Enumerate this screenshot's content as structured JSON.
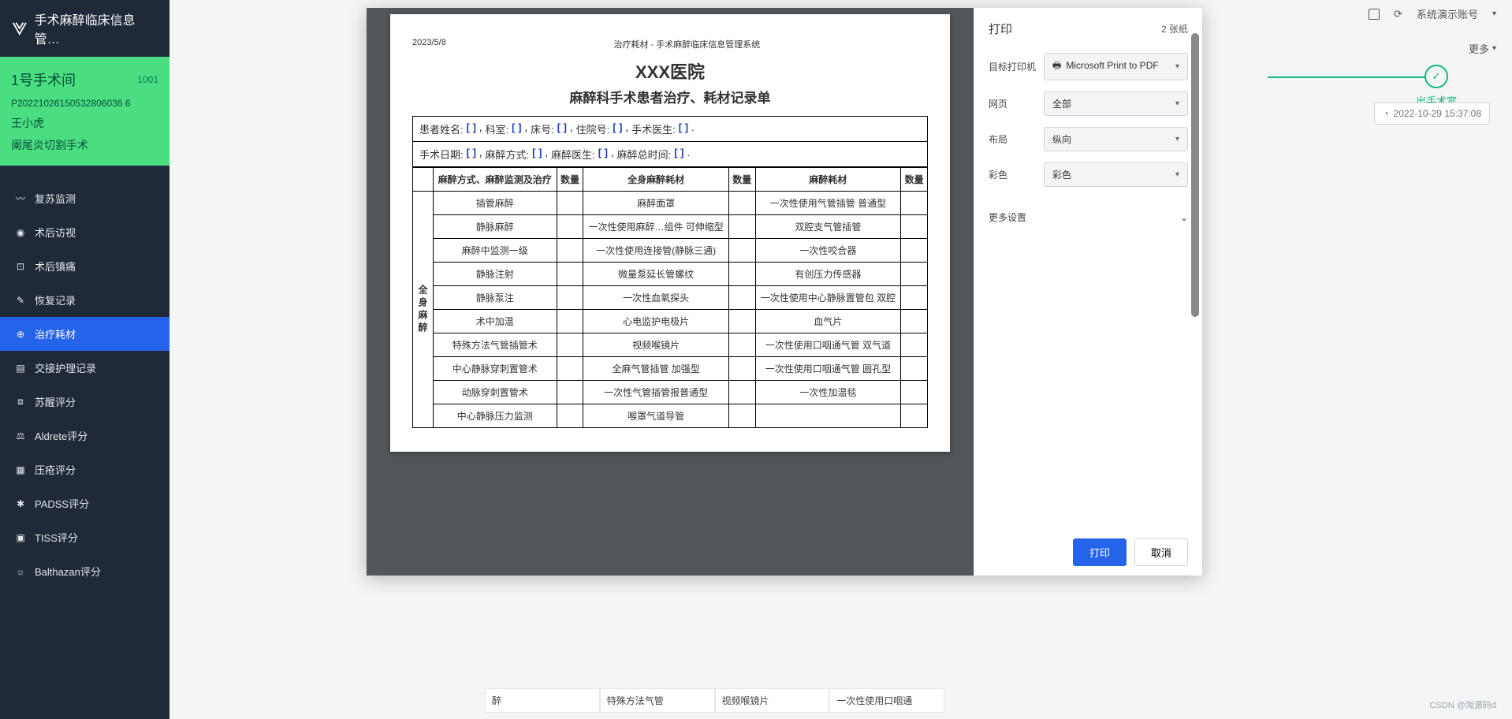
{
  "app_title": "手术麻醉临床信息管…",
  "room": {
    "name": "1号手术间",
    "number": "1001"
  },
  "patient": {
    "id": "P20221026150532806036 6",
    "name": "王小虎",
    "surgery": "阑尾炎切割手术"
  },
  "nav": [
    {
      "icon": "〰",
      "label": "复苏监测"
    },
    {
      "icon": "◉",
      "label": "术后访视"
    },
    {
      "icon": "⊡",
      "label": "术后镇痛"
    },
    {
      "icon": "✎",
      "label": "恢复记录"
    },
    {
      "icon": "⊕",
      "label": "治疗耗材"
    },
    {
      "icon": "▤",
      "label": "交接护理记录"
    },
    {
      "icon": "⧈",
      "label": "苏醒评分"
    },
    {
      "icon": "⚖",
      "label": "Aldrete评分"
    },
    {
      "icon": "▦",
      "label": "压疮评分"
    },
    {
      "icon": "✱",
      "label": "PADSS评分"
    },
    {
      "icon": "▣",
      "label": "TISS评分"
    },
    {
      "icon": "☼",
      "label": "Balthazan评分"
    }
  ],
  "topbar": {
    "account": "系统演示账号",
    "more": "更多"
  },
  "step": {
    "label": "出手术室",
    "timestamp": "2022-10-29 15:37:08"
  },
  "print": {
    "title": "打印",
    "sheets": "2 张纸",
    "settings": [
      {
        "label": "目标打印机",
        "value": "Microsoft Print to PDF",
        "icon": true
      },
      {
        "label": "网页",
        "value": "全部"
      },
      {
        "label": "布局",
        "value": "纵向"
      },
      {
        "label": "彩色",
        "value": "彩色"
      }
    ],
    "more_settings": "更多设置",
    "print_btn": "打印",
    "cancel_btn": "取消"
  },
  "doc": {
    "date": "2023/5/8",
    "header": "治疗耗材 - 手术麻醉临床信息管理系统",
    "hospital": "XXX医院",
    "title": "麻醉科手术患者治疗、耗材记录单",
    "info1": [
      "患者姓名:",
      "科室:",
      "床号:",
      "住院号:",
      "手术医生:"
    ],
    "info2": [
      "手术日期:",
      "麻醉方式:",
      "麻醉医生:",
      "麻醉总时间:"
    ],
    "table_head": [
      "麻醉方式、麻醉监测及治疗",
      "数量",
      "全身麻醉耗材",
      "数量",
      "麻醉耗材",
      "数量"
    ],
    "vcol_label": "全身麻醉",
    "rows": [
      [
        "插管麻醉",
        "",
        "麻醉面罩",
        "",
        "一次性使用气管插管 普通型",
        ""
      ],
      [
        "静脉麻醉",
        "",
        "一次性使用麻醉…组件 可伸缩型",
        "",
        "双腔支气管插管",
        ""
      ],
      [
        "麻醉中监测一级",
        "",
        "一次性使用连接管(静脉三通)",
        "",
        "一次性咬合器",
        ""
      ],
      [
        "静脉注射",
        "",
        "微量泵延长管螺纹",
        "",
        "有创压力传感器",
        ""
      ],
      [
        "静脉泵注",
        "",
        "一次性血氧探头",
        "",
        "一次性使用中心静脉置管包 双腔",
        ""
      ],
      [
        "术中加温",
        "",
        "心电监护电极片",
        "",
        "血气片",
        ""
      ],
      [
        "特殊方法气管插管术",
        "",
        "视频喉镜片",
        "",
        "一次性使用口咽通气管 双气道",
        ""
      ],
      [
        "中心静脉穿刺置管术",
        "",
        "全麻气管插管 加强型",
        "",
        "一次性使用口咽通气管 圆孔型",
        ""
      ],
      [
        "动脉穿刺置管术",
        "",
        "一次性气管插管报普通型",
        "",
        "一次性加温毯",
        ""
      ],
      [
        "中心静脉压力监测",
        "",
        "喉罩气道导管",
        "",
        "",
        ""
      ]
    ]
  },
  "bg_row": [
    "醉",
    "特殊方法气管",
    "视频喉镜片",
    "一次性使用口咽通"
  ],
  "watermark": "CSDN @淘源码d"
}
